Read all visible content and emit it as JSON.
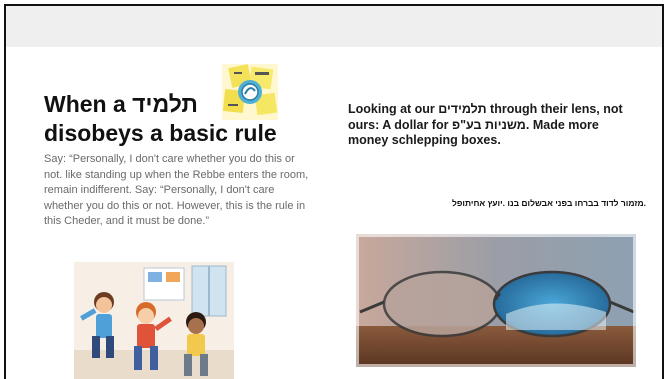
{
  "slide": {
    "left": {
      "title_line1": "When a תלמיד",
      "title_line2": "disobeys a basic rule",
      "body": "Say: “Personally, I don't care whether you do this or not. like standing up when the Rebbe enters the room, remain indifferent. Say: “Personally, I don't care whether you do this or not. However, this is the rule in this Cheder, and it must be done.”",
      "sticky_note_icon": "sticky-notes-rules-icon",
      "kids_image": "kids-playing-illustration"
    },
    "right": {
      "title": "Looking at our תלמידים through their lens, not ours: A dollar for משניות בע\"פ. Made more money schlepping boxes.",
      "subtitle": ".מזמור לדוד בברחו בפני אבשלום בנו .יועץ אחיתופל",
      "glasses_image": "eyeglasses-on-table-photo"
    }
  },
  "colors": {
    "topbar": "#efefef",
    "title_text": "#111111",
    "body_text": "#6a6a6a"
  }
}
